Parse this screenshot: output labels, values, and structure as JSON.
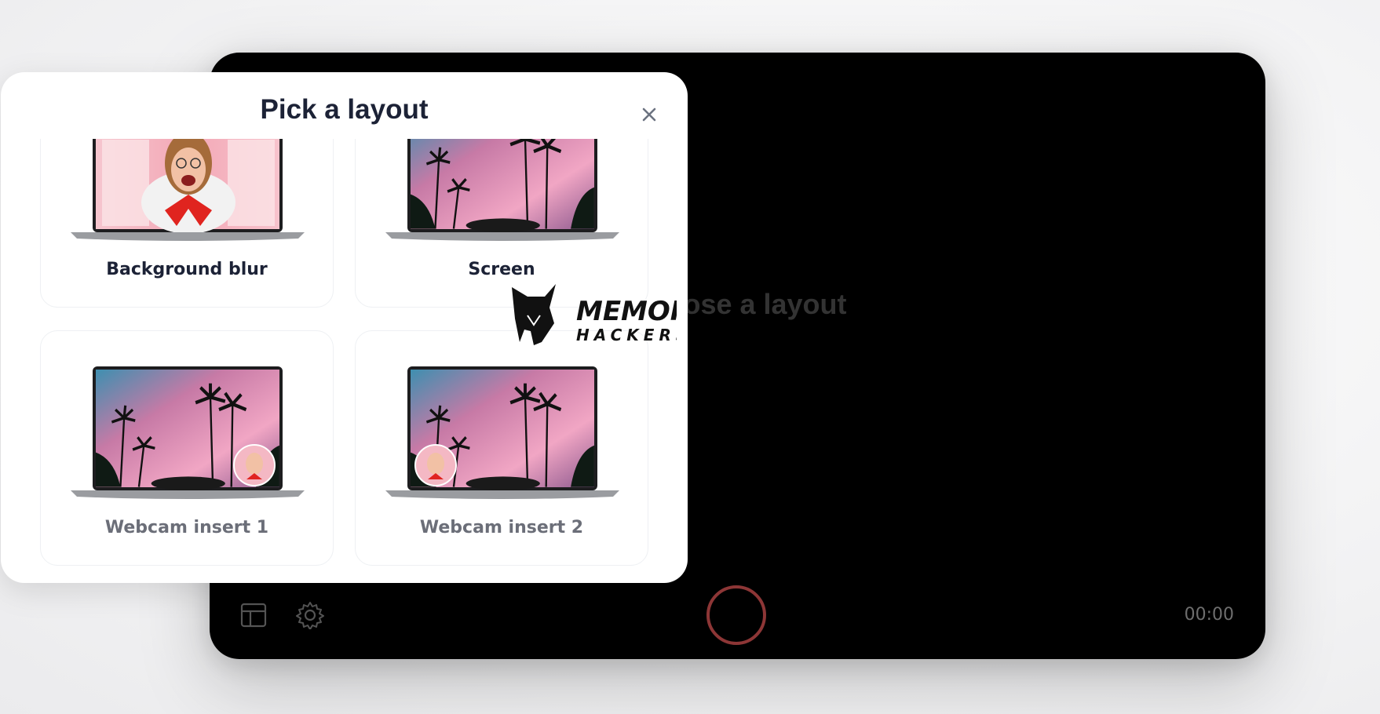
{
  "recorder": {
    "placeholder": "Choose a layout",
    "timer": "00:00",
    "record_color": "#8d3636"
  },
  "modal": {
    "title": "Pick a layout",
    "close_icon": "close-icon",
    "layouts": [
      {
        "label": "Background blur",
        "thumbnail": "laptop-blurred-person"
      },
      {
        "label": "Screen",
        "thumbnail": "laptop-palm-trees"
      },
      {
        "label": "Webcam insert 1",
        "thumbnail": "laptop-palm-trees-webcam-right"
      },
      {
        "label": "Webcam insert 2",
        "thumbnail": "laptop-palm-trees-webcam-left"
      }
    ]
  },
  "watermark": {
    "line1": "MEMORY",
    "line2": "HACKERS"
  }
}
